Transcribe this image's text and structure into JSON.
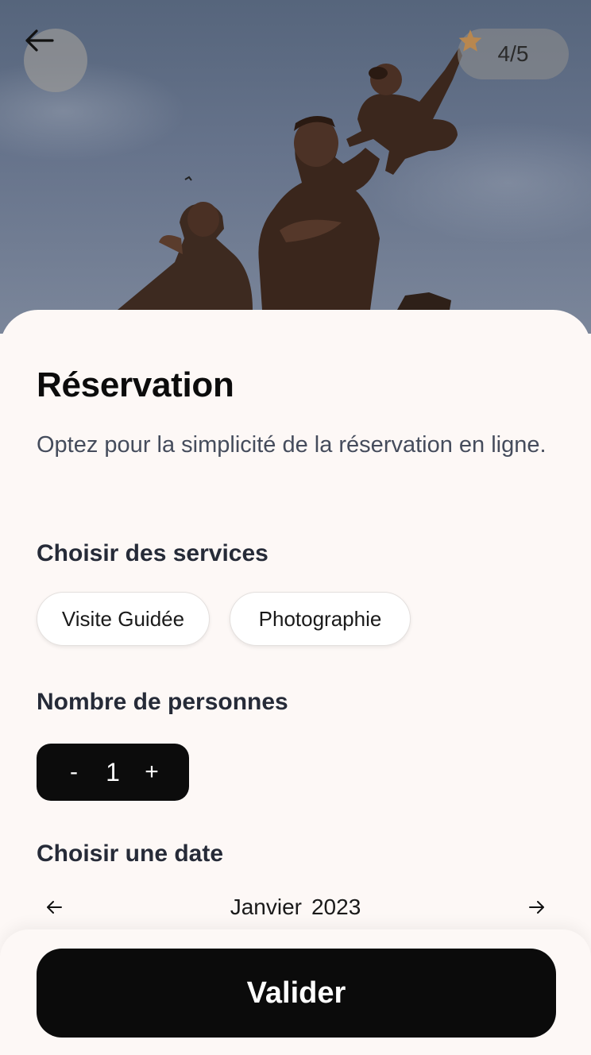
{
  "hero": {
    "image_icon": "monument-statue-photo",
    "back_icon": "arrow-left-icon",
    "rating": "4/5",
    "rating_icon": "star-icon",
    "star_color": "#b8874f"
  },
  "sheet": {
    "title": "Réservation",
    "subtitle": "Optez pour la simplicité de la réservation en ligne.",
    "services_label": "Choisir des services",
    "services": [
      {
        "label": "Visite Guidée"
      },
      {
        "label": "Photographie"
      }
    ],
    "people_label": "Nombre de personnes",
    "stepper": {
      "minus": "-",
      "value": "1",
      "plus": "+"
    },
    "date_label": "Choisir une date",
    "calendar": {
      "month": "Janvier",
      "year": "2023",
      "prev_icon": "arrow-left-icon",
      "next_icon": "arrow-right-icon"
    }
  },
  "footer": {
    "validate_label": "Valider"
  }
}
